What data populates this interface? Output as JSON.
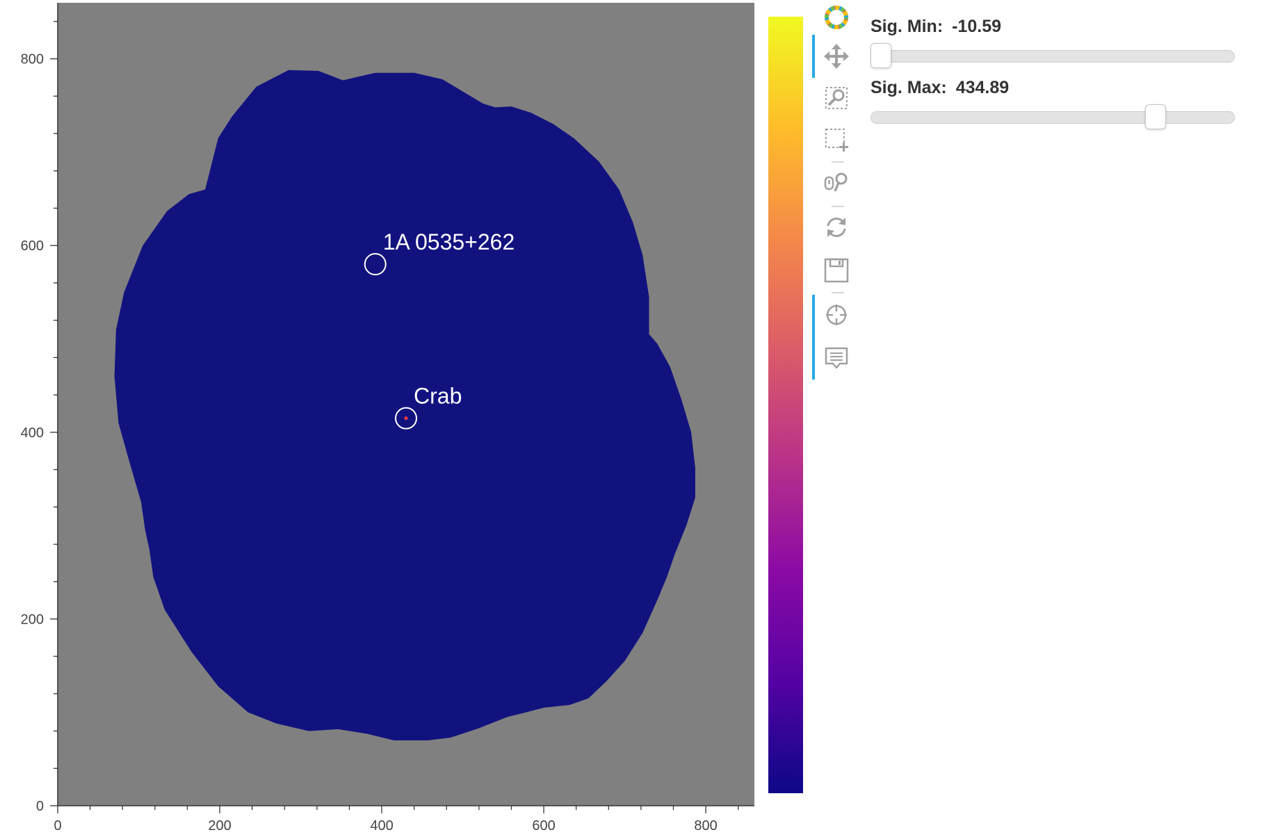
{
  "chart_data": {
    "type": "heatmap",
    "title": "",
    "xlabel": "",
    "ylabel": "",
    "xlim": [
      0,
      860
    ],
    "ylim": [
      0,
      860
    ],
    "x_ticks": [
      "0",
      "200",
      "400",
      "600",
      "800"
    ],
    "y_ticks": [
      "0",
      "200",
      "400",
      "600",
      "800"
    ],
    "colormap": "plasma",
    "nan_color": "#808080",
    "map_color": "#12127f",
    "annotations": [
      {
        "label": "1A 0535+262",
        "x": 392,
        "y": 580
      },
      {
        "label": "Crab",
        "x": 430,
        "y": 415
      }
    ],
    "colorbar": {
      "colors": [
        "#0d0887",
        "#5402a3",
        "#8b0aa5",
        "#b83289",
        "#db5c68",
        "#f48849",
        "#febd2a",
        "#f0f921"
      ]
    }
  },
  "toolbar": {
    "logo": "bokeh-logo-icon",
    "tools": [
      {
        "name": "pan-icon",
        "active": true
      },
      {
        "name": "box-zoom-icon",
        "active": false
      },
      {
        "name": "box-select-icon",
        "active": false
      },
      {
        "name": "wheel-zoom-icon",
        "active": false
      },
      {
        "name": "reset-icon",
        "active": false
      },
      {
        "name": "save-icon",
        "active": false
      },
      {
        "name": "crosshair-icon",
        "active": true
      },
      {
        "name": "hover-icon",
        "active": true
      }
    ],
    "accent_color": "#26aae1"
  },
  "sliders": {
    "min": {
      "label": "Sig. Min:",
      "value": "-10.59",
      "fraction": 0.0
    },
    "max": {
      "label": "Sig. Max:",
      "value": "434.89",
      "fraction": 0.8
    }
  }
}
